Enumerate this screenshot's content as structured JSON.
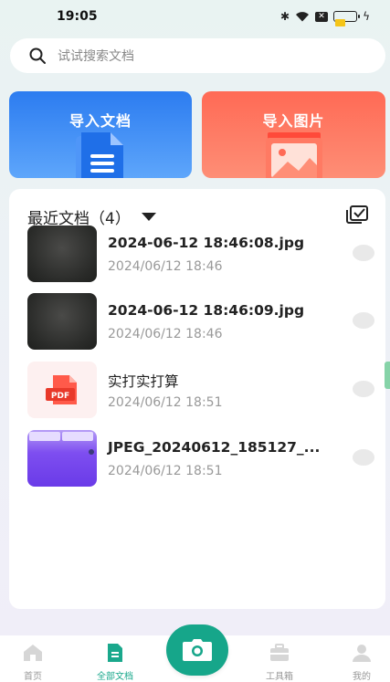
{
  "status_bar": {
    "time": "19:05",
    "battery_level": 0.5,
    "icons": [
      "bluetooth-icon",
      "wifi-icon",
      "sim-x-icon",
      "battery-icon",
      "charging-icon"
    ]
  },
  "search": {
    "placeholder": "试试搜索文档"
  },
  "import_cards": [
    {
      "label": "导入文档",
      "icon": "document-icon",
      "color": "#2c7cf0"
    },
    {
      "label": "导入图片",
      "icon": "image-icon",
      "color": "#ff6a55"
    }
  ],
  "recent": {
    "title": "最近文档（4）",
    "items": [
      {
        "name": "2024-06-12 18:46:08.jpg",
        "date": "2024/06/12 18:46",
        "thumb": "dark-photo"
      },
      {
        "name": "2024-06-12 18:46:09.jpg",
        "date": "2024/06/12 18:46",
        "thumb": "dark-photo"
      },
      {
        "name": "实打实打算",
        "date": "2024/06/12 18:51",
        "thumb": "pdf-icon",
        "badge": "PDF"
      },
      {
        "name": "JPEG_20240612_185127_...",
        "date": "2024/06/12 18:51",
        "thumb": "purple-screenshot"
      }
    ]
  },
  "bottom_nav": {
    "items": [
      {
        "label": "首页",
        "icon": "home-icon",
        "active": false
      },
      {
        "label": "全部文档",
        "icon": "document-icon",
        "active": true
      },
      {
        "label": "工具箱",
        "icon": "toolbox-icon",
        "active": false
      },
      {
        "label": "我的",
        "icon": "profile-icon",
        "active": false
      }
    ],
    "camera_icon": "camera-icon"
  },
  "colors": {
    "accent": "#16a68a",
    "doc_card": "#2c7cf0",
    "img_card": "#ff6a55"
  }
}
